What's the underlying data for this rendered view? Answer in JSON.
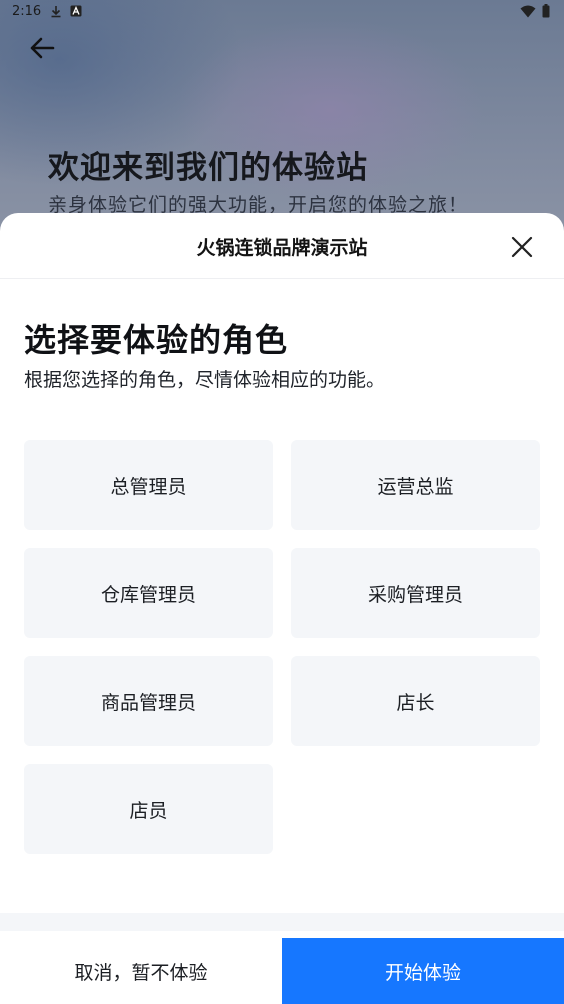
{
  "status_bar": {
    "time": "2:16",
    "icons_left": [
      "download-icon",
      "a-icon"
    ],
    "icons_right": [
      "wifi-icon",
      "battery-icon"
    ]
  },
  "background": {
    "title": "欢迎来到我们的体验站",
    "subtitle": "亲身体验它们的强大功能，开启您的体验之旅！"
  },
  "sheet": {
    "title": "火锅连锁品牌演示站",
    "heading": "选择要体验的角色",
    "description": "根据您选择的角色，尽情体验相应的功能。",
    "roles": [
      "总管理员",
      "运营总监",
      "仓库管理员",
      "采购管理员",
      "商品管理员",
      "店长",
      "店员"
    ]
  },
  "footer": {
    "cancel_label": "取消，暂不体验",
    "start_label": "开始体验"
  },
  "colors": {
    "primary": "#1677ff",
    "card_bg": "#f4f6f9"
  }
}
